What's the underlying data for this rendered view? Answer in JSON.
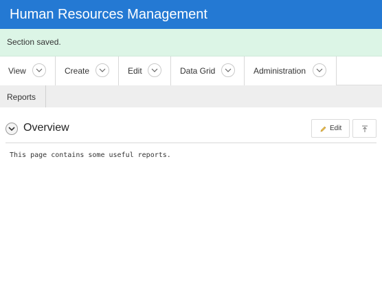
{
  "app": {
    "title": "Human Resources Management"
  },
  "alert": {
    "message": "Section saved."
  },
  "menu": {
    "items": [
      {
        "label": "View",
        "icon": "chevron-down-icon"
      },
      {
        "label": "Create",
        "icon": "chevron-down-icon"
      },
      {
        "label": "Edit",
        "icon": "chevron-down-icon"
      },
      {
        "label": "Data Grid",
        "icon": "chevron-down-icon"
      },
      {
        "label": "Administration",
        "icon": "chevron-down-icon"
      }
    ],
    "row2": [
      {
        "label": "Reports"
      }
    ]
  },
  "region": {
    "title": "Overview",
    "edit_label": "Edit",
    "body": "This page contains some useful reports."
  },
  "colors": {
    "header": "#2479d3",
    "success_bg": "#dcf5e6",
    "menu_bg": "#eeeeee"
  }
}
